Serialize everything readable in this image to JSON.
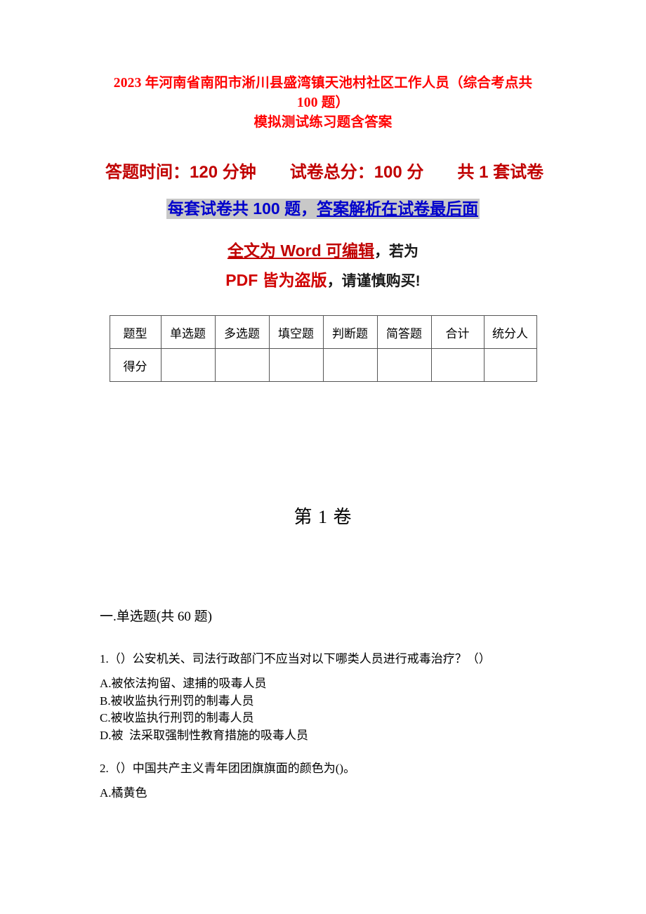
{
  "document": {
    "title_lines": [
      "2023 年河南省南阳市淅川县盛湾镇天池村社区工作人员（综合考点共 100 题）",
      "模拟测试练习题含答案"
    ],
    "banner": {
      "exam_info": "答题时间：120 分钟　　试卷总分：100 分　　共 1 套试卷",
      "highlight_plain": "每套试卷共 100 题，",
      "highlight_underlined": "答案解析在试卷最后面",
      "notice_part_1": "全文为 Word 可编辑",
      "notice_part_2": "，若为 ",
      "notice_part_3": "PDF 皆为盗版",
      "notice_part_4": "，请谨慎购买!"
    },
    "score_table": {
      "headers": [
        "题型",
        "单选题",
        "多选题",
        "填空题",
        "判断题",
        "简答题",
        "合计",
        "统分人"
      ],
      "rows": [
        {
          "label": "得分",
          "cells": [
            "",
            "",
            "",
            "",
            "",
            "",
            ""
          ]
        }
      ]
    },
    "volume_heading": "第 1 卷",
    "section_heading": "一.单选题(共 60 题)",
    "questions": [
      {
        "stem": "1.（）公安机关、司法行政部门不应当对以下哪类人员进行戒毒治疗？（）",
        "options": [
          "A.被依法拘留、逮捕的吸毒人员",
          "B.被收监执行刑罚的制毒人员",
          "C.被收监执行刑罚的制毒人员",
          "D.被  法采取强制性教育措施的吸毒人员"
        ]
      },
      {
        "stem": "2.（）中国共产主义青年团团旗旗面的颜色为()。",
        "options": [
          "A.橘黄色"
        ]
      }
    ]
  },
  "colors": {
    "title_red": "#ff0000",
    "banner_red": "#c00000",
    "highlight_blue": "#0000cc",
    "highlight_bg": "#c8c8c8",
    "strong_red": "#d00000",
    "body_text": "#000000",
    "table_border": "#555555"
  }
}
